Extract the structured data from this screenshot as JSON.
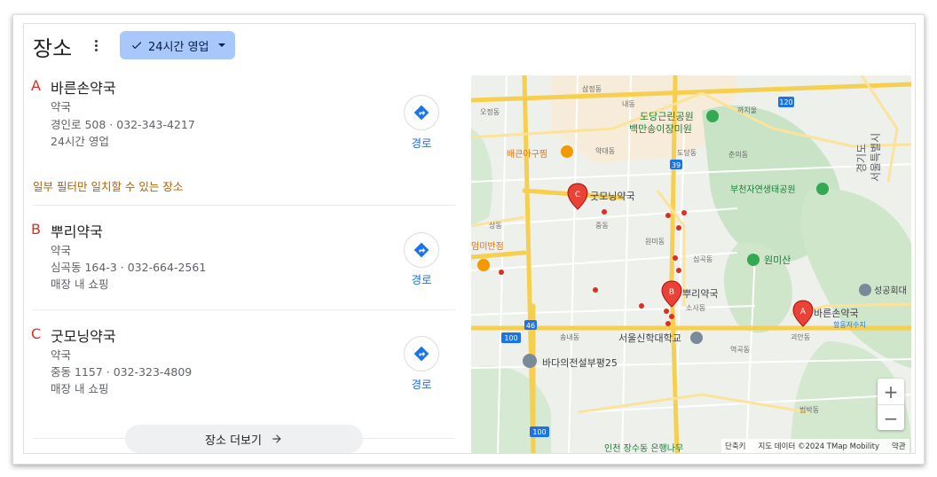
{
  "header": {
    "title": "장소",
    "filter_chip_label": "24시간 영업"
  },
  "places": [
    {
      "letter": "A",
      "name": "바른손약국",
      "category": "약국",
      "address_phone": "경인로 508 · 032-343-4217",
      "extra": "24시간 영업",
      "directions_label": "경로"
    },
    {
      "letter": "B",
      "name": "뿌리약국",
      "category": "약국",
      "address_phone": "심곡동 164-3 · 032-664-2561",
      "extra": "매장 내 쇼핑",
      "directions_label": "경로"
    },
    {
      "letter": "C",
      "name": "굿모닝약국",
      "category": "약국",
      "address_phone": "중동 1157 · 032-323-4809",
      "extra": "매장 내 쇼핑",
      "directions_label": "경로"
    }
  ],
  "partial_match_note": "일부 필터만 일치할 수 있는 장소",
  "more_places_label": "장소 더보기",
  "map": {
    "pins": [
      {
        "letter": "A",
        "label": "바른손약국"
      },
      {
        "letter": "B",
        "label": "뿌리약국"
      },
      {
        "letter": "C",
        "label": "굿모닝약국"
      }
    ],
    "labels": {
      "dodang_park": "도당근린공원",
      "baekman": "백만송이장미원",
      "bucheon_forest": "부천자연생태공원",
      "wonmisan": "원미산",
      "seoul_theological": "서울신학대학교",
      "badaui": "바다의전설부평25",
      "baekeun": "배큰아구찜",
      "ummi": "엄미반점",
      "seongong": "성공회대",
      "hangdong": "항동저수지",
      "gyeonggido": "경기도",
      "seoul": "서울특별시",
      "incheon": "인천 장수동 은행나무",
      "samjeong": "삼정동",
      "naedong": "내동",
      "yakdae": "약대동",
      "dodang": "도당동",
      "chunui": "춘의동",
      "jungdong": "중동",
      "simgok": "심곡동",
      "wonmi": "원미동",
      "sosa": "소사동",
      "goean": "괴안동",
      "songnae": "송내동",
      "beomb": "범박동",
      "yeokgok": "역곡동",
      "sangdong": "상동",
      "ojeong": "오정동",
      "ggachiul": "까치울"
    },
    "roads": [
      "120",
      "39",
      "46",
      "100"
    ],
    "zoom_in": "+",
    "zoom_out": "−",
    "attribution": {
      "shortcuts": "단축키",
      "data": "지도 데이터 ©2024 TMap Mobility",
      "terms": "약관"
    }
  },
  "colors": {
    "accent": "#1a73e8",
    "pin_red": "#ea4335",
    "chip_bg": "#a8c7fa",
    "orange_note": "#b06000",
    "park_green": "#34a853"
  }
}
